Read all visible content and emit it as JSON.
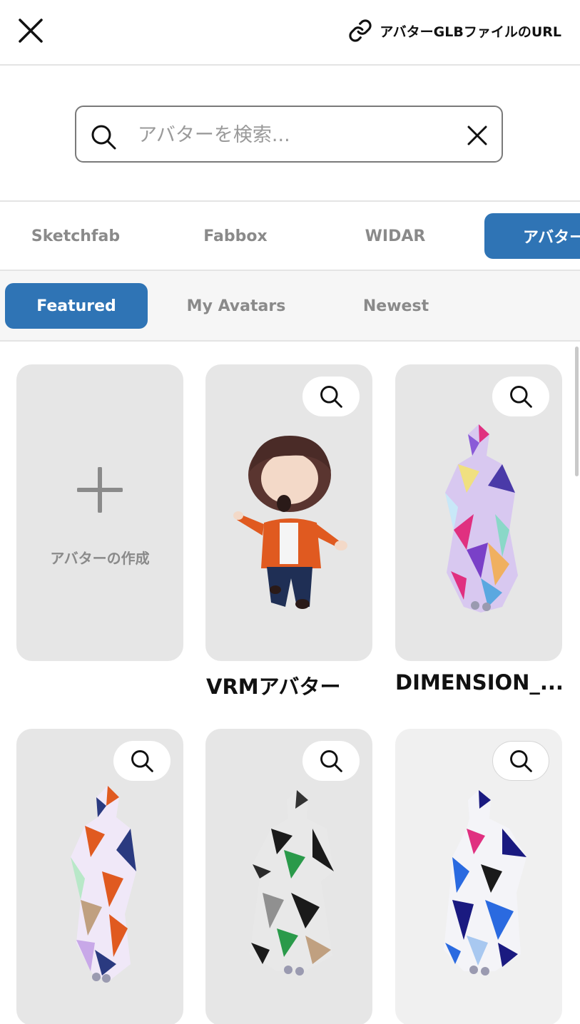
{
  "header": {
    "close_icon": "close-icon",
    "url_link_label": "アバターGLBファイルのURL",
    "url_link_icon": "link-icon"
  },
  "search": {
    "placeholder": "アバターを検索...",
    "value": "",
    "icon": "search-icon",
    "clear_icon": "close-icon"
  },
  "source_tabs": [
    {
      "label": "Sketchfab",
      "active": false
    },
    {
      "label": "Fabbox",
      "active": false
    },
    {
      "label": "WIDAR",
      "active": false
    },
    {
      "label": "アバター",
      "active": true
    }
  ],
  "sub_tabs": [
    {
      "label": "Featured",
      "active": true
    },
    {
      "label": "My Avatars",
      "active": false
    },
    {
      "label": "Newest",
      "active": false
    }
  ],
  "create_card": {
    "icon": "plus-icon",
    "label": "アバターの作成"
  },
  "avatars": [
    {
      "title": "VRMアバター",
      "thumb": "chibi-character"
    },
    {
      "title": "DIMENSION_...",
      "thumb": "polygon-figure-pastel"
    },
    {
      "title": "",
      "thumb": "polygon-figure-orange"
    },
    {
      "title": "",
      "thumb": "polygon-figure-gray"
    },
    {
      "title": "",
      "thumb": "polygon-figure-blue"
    }
  ],
  "colors": {
    "accent": "#2f74b5",
    "muted_text": "#8a8a8a",
    "card_bg": "#e6e6e6"
  }
}
